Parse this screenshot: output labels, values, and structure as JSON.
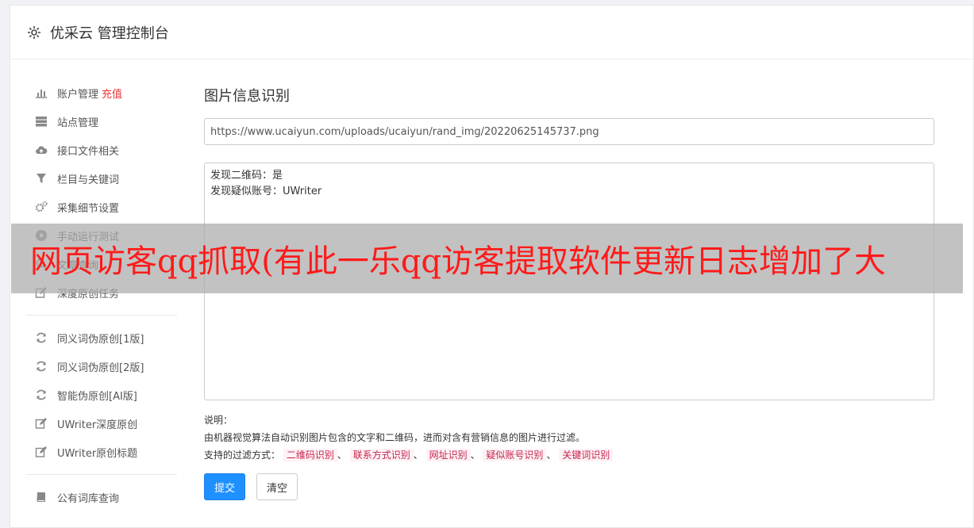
{
  "header": {
    "title": "优采云 管理控制台"
  },
  "sidebar": {
    "group1": [
      {
        "label": "账户管理",
        "badge": "充值",
        "icon": "bar-chart-icon"
      },
      {
        "label": "站点管理",
        "icon": "server-icon"
      },
      {
        "label": "接口文件相关",
        "icon": "cloud-upload-icon"
      },
      {
        "label": "栏目与关键词",
        "icon": "filter-icon"
      },
      {
        "label": "采集细节设置",
        "icon": "cogs-icon"
      },
      {
        "label": "手动运行测试",
        "icon": "play-icon"
      },
      {
        "label": "文章查询",
        "icon": "search-icon"
      },
      {
        "label": "深度原创任务",
        "icon": "edit-icon"
      }
    ],
    "group2": [
      {
        "label": "同义词伪原创[1版]",
        "icon": "refresh-icon"
      },
      {
        "label": "同义词伪原创[2版]",
        "icon": "refresh-icon"
      },
      {
        "label": "智能伪原创[AI版]",
        "icon": "refresh-icon"
      },
      {
        "label": "UWriter深度原创",
        "icon": "edit-icon"
      },
      {
        "label": "UWriter原创标题",
        "icon": "edit-icon"
      }
    ],
    "group3": [
      {
        "label": "公有词库查询",
        "icon": "book-icon"
      }
    ]
  },
  "main": {
    "title": "图片信息识别",
    "url_value": "https://www.ucaiyun.com/uploads/ucaiyun/rand_img/20220625145737.png",
    "result_lines": [
      "发现二维码：是",
      "发现疑似账号：UWriter"
    ],
    "desc_label": "说明：",
    "desc_text": "由机器视觉算法自动识别图片包含的文字和二维码，进而对含有营销信息的图片进行过滤。",
    "filter_label": "支持的过滤方式：",
    "filters": [
      "二维码识别",
      "联系方式识别",
      "网址识别",
      "疑似账号识别",
      "关键词识别"
    ],
    "filter_sep": "、",
    "submit_label": "提交",
    "clear_label": "清空"
  },
  "overlay": {
    "text": "网页访客qq抓取(有此一乐qq访客提取软件更新日志增加了大"
  },
  "colors": {
    "primary": "#1e90ff",
    "badge": "#e33333",
    "tag_text": "#c7254e",
    "tag_bg": "#fdf2f5",
    "overlay_text": "#ff1a1a"
  }
}
